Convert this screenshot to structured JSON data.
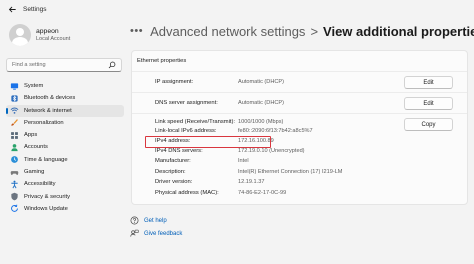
{
  "window": {
    "title": "Settings"
  },
  "profile": {
    "name": "appeon",
    "account_type": "Local Account"
  },
  "search": {
    "placeholder": "Find a setting"
  },
  "sidebar": {
    "items": [
      {
        "label": "System",
        "icon": "monitor-icon",
        "color": "#1a73e8",
        "active": false
      },
      {
        "label": "Bluetooth & devices",
        "icon": "bluetooth-icon",
        "color": "#2f6fbf",
        "active": false
      },
      {
        "label": "Network & internet",
        "icon": "wifi-icon",
        "color": "#3a6fb5",
        "active": true
      },
      {
        "label": "Personalization",
        "icon": "brush-icon",
        "color": "#e8912d",
        "active": false
      },
      {
        "label": "Apps",
        "icon": "apps-icon",
        "color": "#5b6b7a",
        "active": false
      },
      {
        "label": "Accounts",
        "icon": "person-icon",
        "color": "#2aa36b",
        "active": false
      },
      {
        "label": "Time & language",
        "icon": "globe-clock-icon",
        "color": "#2b8fd8",
        "active": false
      },
      {
        "label": "Gaming",
        "icon": "gamepad-icon",
        "color": "#7a7a7a",
        "active": false
      },
      {
        "label": "Accessibility",
        "icon": "accessibility-icon",
        "color": "#1d6fc4",
        "active": false
      },
      {
        "label": "Privacy & security",
        "icon": "shield-icon",
        "color": "#6b7480",
        "active": false
      },
      {
        "label": "Windows Update",
        "icon": "update-icon",
        "color": "#1a73e8",
        "active": false
      }
    ]
  },
  "breadcrumb": {
    "parent": "Advanced network settings",
    "separator": ">",
    "current": "View additional properties"
  },
  "panel": {
    "title": "Ethernet properties",
    "rows": [
      {
        "label": "IP assignment:",
        "value": "Automatic (DHCP)"
      },
      {
        "label": "DNS server assignment:",
        "value": "Automatic (DHCP)"
      },
      {
        "label": "Link speed (Receive/Transmit):",
        "value": "1000/1000 (Mbps)"
      },
      {
        "label": "Link-local IPv6 address:",
        "value": "fe80::2090:6f13:7b42:a8c5%7"
      },
      {
        "label": "IPv4 address:",
        "value": "172.16.100.89"
      },
      {
        "label": "IPv4 DNS servers:",
        "value": "172.19.0.10 (Unencrypted)"
      },
      {
        "label": "Manufacturer:",
        "value": "Intel"
      },
      {
        "label": "Description:",
        "value": "Intel(R) Ethernet Connection (17) I219-LM"
      },
      {
        "label": "Driver version:",
        "value": "12.19.1.37"
      },
      {
        "label": "Physical address (MAC):",
        "value": "74-86-E2-17-0C-99"
      }
    ],
    "buttons": {
      "edit_ip": "Edit",
      "edit_dns": "Edit",
      "copy": "Copy"
    }
  },
  "help": {
    "get_help": "Get help",
    "give_feedback": "Give feedback"
  },
  "colors": {
    "accent": "#0067c0",
    "link": "#005fb8",
    "highlight": "#d9363e"
  }
}
